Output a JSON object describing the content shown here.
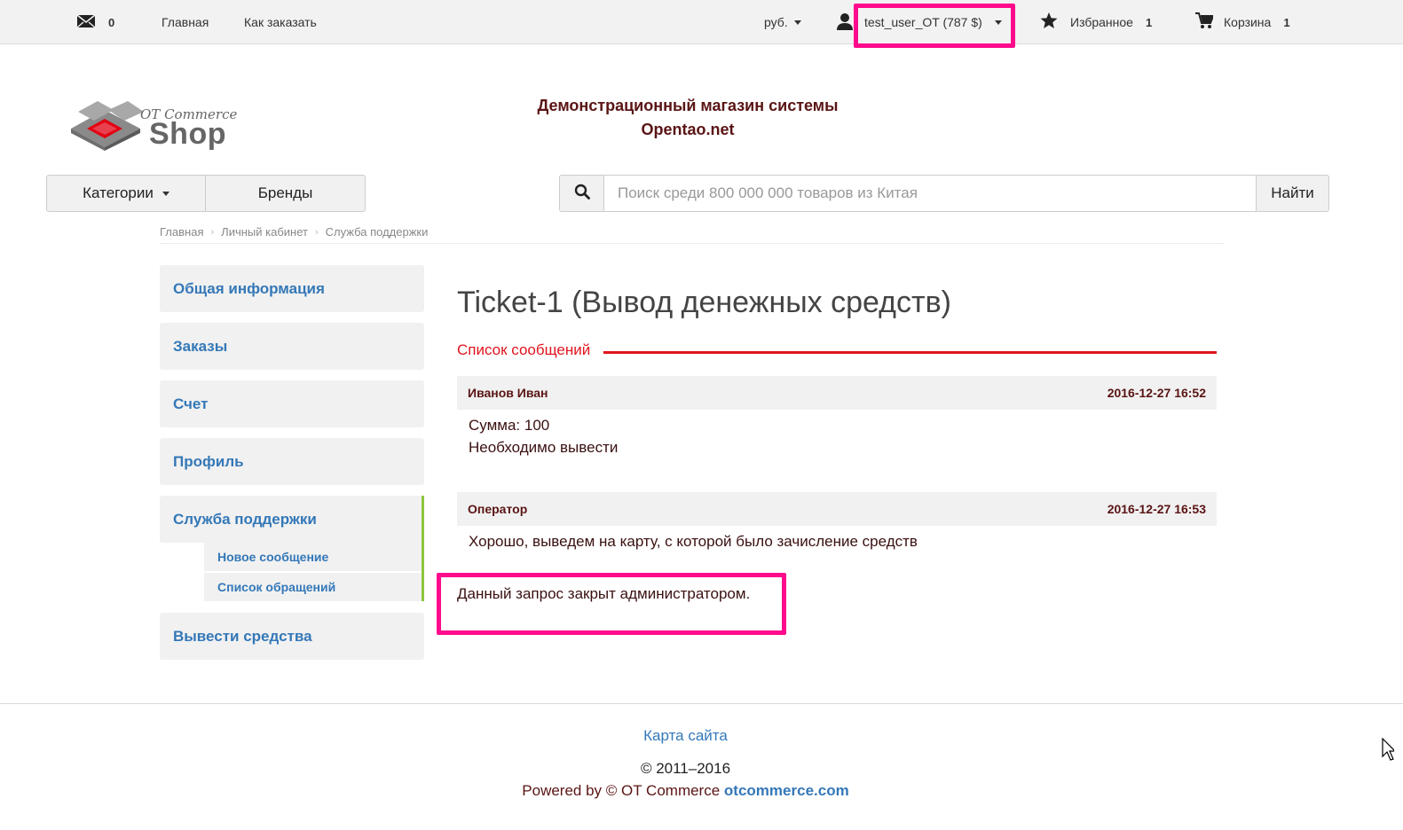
{
  "topbar": {
    "messages_count": "0",
    "nav_home": "Главная",
    "nav_how_to_order": "Как заказать",
    "currency": "руб.",
    "user": "test_user_OT (787 $)",
    "favorites_label": "Избранное",
    "favorites_count": "1",
    "cart_label": "Корзина",
    "cart_count": "1"
  },
  "header": {
    "logo_line1": "OT Commerce",
    "logo_line2": "Shop",
    "site_title_line1": "Демонстрационный магазин системы",
    "site_title_line2": "Opentao.net"
  },
  "nav": {
    "categories": "Категории",
    "brands": "Бренды"
  },
  "search": {
    "placeholder": "Поиск среди 800 000 000 товаров из Китая",
    "button": "Найти"
  },
  "breadcrumb": [
    "Главная",
    "Личный кабинет",
    "Служба поддержки"
  ],
  "sidebar": {
    "items": [
      {
        "label": "Общая информация"
      },
      {
        "label": "Заказы"
      },
      {
        "label": "Счет"
      },
      {
        "label": "Профиль"
      },
      {
        "label": "Служба поддержки"
      },
      {
        "label": "Вывести средства"
      }
    ],
    "subitems": [
      {
        "label": "Новое сообщение"
      },
      {
        "label": "Список обращений"
      }
    ]
  },
  "ticket": {
    "title": "Ticket-1 (Вывод денежных средств)",
    "messages_label": "Список сообщений",
    "messages": [
      {
        "author": "Иванов Иван",
        "datetime": "2016-12-27 16:52",
        "lines": [
          "Сумма: 100",
          "Необходимо вывести"
        ]
      },
      {
        "author": "Оператор",
        "datetime": "2016-12-27 16:53",
        "lines": [
          "Хорошо, выведем на карту, с которой было зачисление средств"
        ]
      }
    ],
    "closed_note": "Данный запрос закрыт администратором."
  },
  "footer": {
    "sitemap": "Карта сайта",
    "copyright": "© 2011–2016",
    "powered_prefix": "Powered by © OT Commerce",
    "powered_link": "otcommerce.com"
  },
  "colors": {
    "highlight": "#ff0a8c",
    "accent_red": "#e0141e",
    "link_blue": "#3478b8",
    "active_green": "#8cc63f"
  },
  "icons": [
    "envelope-icon",
    "user-icon",
    "star-icon",
    "cart-icon",
    "search-icon",
    "caret-down-icon",
    "breadcrumb-chevron-icon",
    "mouse-cursor-icon"
  ]
}
